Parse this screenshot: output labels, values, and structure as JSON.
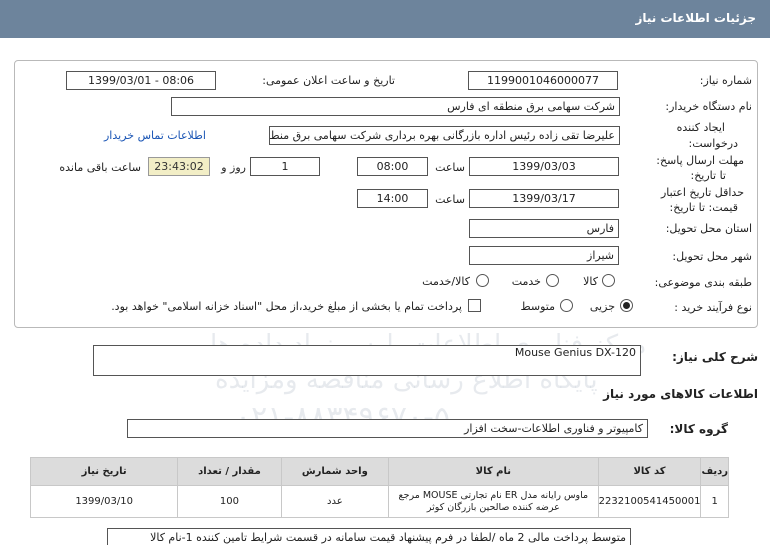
{
  "header": {
    "title": "جزئیات اطلاعات نیاز"
  },
  "form": {
    "need_number_label": "شماره نیاز:",
    "need_number": "1199001046000077",
    "announce_label": "تاریخ و ساعت اعلان عمومی:",
    "announce_value": "1399/03/01 - 08:06",
    "buyer_org_label": "نام دستگاه خریدار:",
    "buyer_org": "شرکت سهامی برق منطقه ای فارس",
    "creator_label_1": "ایجاد کننده",
    "creator_label_2": "درخواست:",
    "creator": "علیرضا  تقی زاده رئیس اداره بازرگانی بهره برداری شرکت سهامی برق منطقه ای فارس",
    "contact_link": "اطلاعات تماس خریدار",
    "reply_deadline_label_1": "مهلت ارسال پاسخ:",
    "reply_deadline_label_2": "تا تاریخ:",
    "reply_date": "1399/03/03",
    "time_label": "ساعت",
    "reply_time": "08:00",
    "days_value": "1",
    "day_and_label": "روز و",
    "remaining_timer": "23:43:02",
    "remaining_label": "ساعت باقی مانده",
    "validity_label_1": "حداقل تاریخ اعتبار",
    "validity_label_2": "قیمت: تا تاریخ:",
    "validity_date": "1399/03/17",
    "validity_time": "14:00",
    "province_label": "استان محل تحویل:",
    "province": "فارس",
    "city_label": "شهر محل تحویل:",
    "city": "شیراز",
    "category_label": "طبقه بندی موضوعی:",
    "category_options": [
      "کالا",
      "خدمت",
      "کالا/خدمت"
    ],
    "process_label": "نوع فرآیند خرید :",
    "process_options": [
      "جزیی",
      "متوسط"
    ],
    "payment_note": "پرداخت تمام یا بخشی از مبلغ خرید،از محل \"اسناد خزانه اسلامی\" خواهد بود."
  },
  "summary": {
    "desc_label": "شرح کلی نیاز:",
    "desc_value": "Mouse Genius DX-120",
    "goods_info_label": "اطلاعات کالاهای مورد نیاز",
    "group_label": "گروه کالا:",
    "group_value": "کامپیوتر و فناوری اطلاعات-سخت افزار"
  },
  "table": {
    "headers": [
      "ردیف",
      "کد کالا",
      "نام کالا",
      "واحد شمارش",
      "مقدار / تعداد",
      "تاریخ نیاز"
    ],
    "rows": [
      {
        "row": "1",
        "code": "2232100541450001",
        "name": "ماوس رایانه مدل ER نام تجارتی MOUSE مرجع عرضه کننده صالحین بازرگان کوثر",
        "unit": "عدد",
        "qty": "100",
        "date": "1399/03/10"
      }
    ]
  },
  "footer_note": "متوسط پرداخت مالی 2 ماه /لطفا در فرم پیشنهاد قیمت سامانه در قسمت شرایط تامین کننده 1-نام کالا",
  "watermark": {
    "line1": "مرکز فناوری اطلاعات پارس نماد داده ها",
    "line2": "پایگاه اطلاع رسانی مناقصه ومزایده",
    "line3": "۰۲۱-۸۸۳۴۹۶۷۰-۵"
  }
}
